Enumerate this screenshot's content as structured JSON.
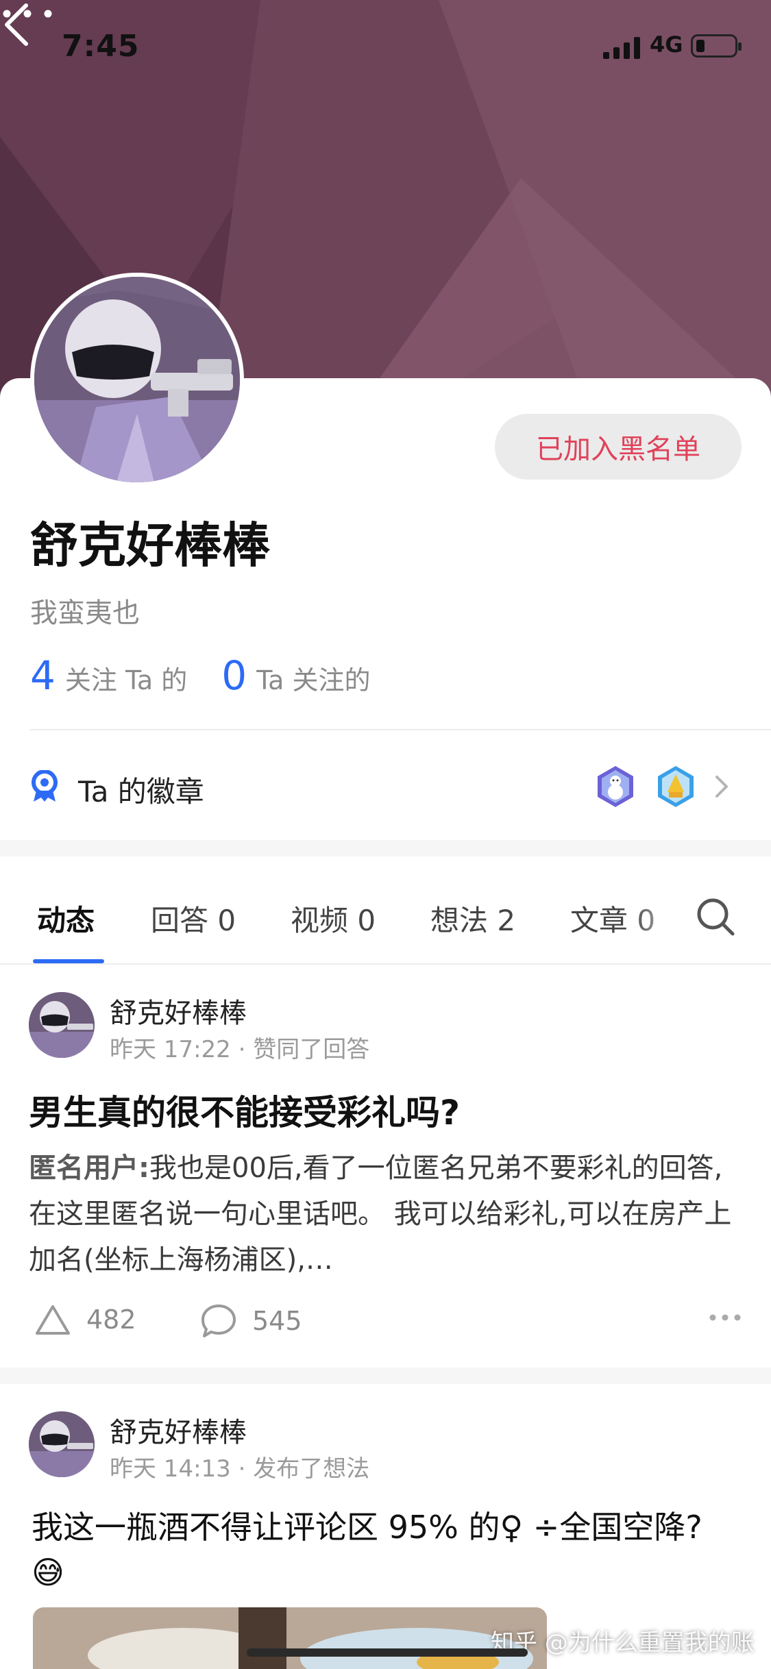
{
  "status_bar": {
    "time": "7:45",
    "network": "4G"
  },
  "header": {
    "back_icon": "chevron-left-icon",
    "more_icon": "more-dots-icon",
    "banner_color": "#5b3449"
  },
  "profile": {
    "name": "舒克好棒棒",
    "bio": "我蛮夷也",
    "blacklist_button": "已加入黑名单",
    "followers_count": "4",
    "followers_label": "关注 Ta 的",
    "following_count": "0",
    "following_label": "Ta 关注的",
    "badges_label": "Ta 的徽章",
    "accent_color": "#2d6bf5"
  },
  "tabs": [
    {
      "label": "动态",
      "active": true
    },
    {
      "label": "回答 0"
    },
    {
      "label": "视频 0"
    },
    {
      "label": "想法 2"
    },
    {
      "label": "文章 0"
    }
  ],
  "feed": [
    {
      "author": "舒克好棒棒",
      "meta": "昨天 17:22 · 赞同了回答",
      "title": "男生真的很不能接受彩礼吗?",
      "excerpt_author": "匿名用户:",
      "excerpt": "我也是00后,看了一位匿名兄弟不要彩礼的回答,在这里匿名说一句心里话吧。 我可以给彩礼,可以在房产上加名(坐标上海杨浦区),…",
      "votes": "482",
      "comments": "545"
    },
    {
      "author": "舒克好棒棒",
      "meta": "昨天 14:13 · 发布了想法",
      "text": "我这一瓶酒不得让评论区 95% 的♀ ÷全国空降? 😅"
    }
  ],
  "watermark": "知乎 @为什么重置我的账"
}
